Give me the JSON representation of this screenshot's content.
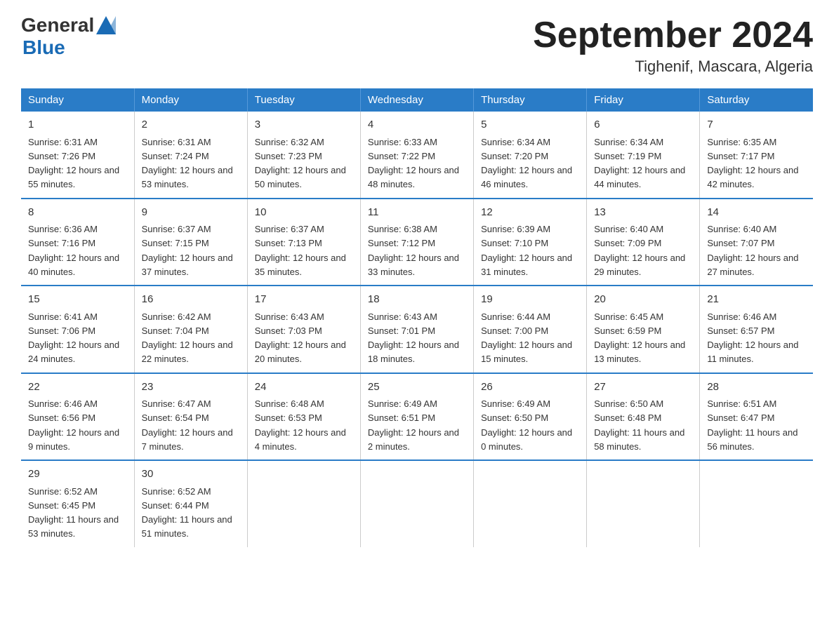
{
  "header": {
    "logo_general": "General",
    "logo_blue": "Blue",
    "month_year": "September 2024",
    "location": "Tighenif, Mascara, Algeria"
  },
  "days_of_week": [
    "Sunday",
    "Monday",
    "Tuesday",
    "Wednesday",
    "Thursday",
    "Friday",
    "Saturday"
  ],
  "weeks": [
    [
      {
        "day": "1",
        "sunrise": "6:31 AM",
        "sunset": "7:26 PM",
        "daylight": "12 hours and 55 minutes."
      },
      {
        "day": "2",
        "sunrise": "6:31 AM",
        "sunset": "7:24 PM",
        "daylight": "12 hours and 53 minutes."
      },
      {
        "day": "3",
        "sunrise": "6:32 AM",
        "sunset": "7:23 PM",
        "daylight": "12 hours and 50 minutes."
      },
      {
        "day": "4",
        "sunrise": "6:33 AM",
        "sunset": "7:22 PM",
        "daylight": "12 hours and 48 minutes."
      },
      {
        "day": "5",
        "sunrise": "6:34 AM",
        "sunset": "7:20 PM",
        "daylight": "12 hours and 46 minutes."
      },
      {
        "day": "6",
        "sunrise": "6:34 AM",
        "sunset": "7:19 PM",
        "daylight": "12 hours and 44 minutes."
      },
      {
        "day": "7",
        "sunrise": "6:35 AM",
        "sunset": "7:17 PM",
        "daylight": "12 hours and 42 minutes."
      }
    ],
    [
      {
        "day": "8",
        "sunrise": "6:36 AM",
        "sunset": "7:16 PM",
        "daylight": "12 hours and 40 minutes."
      },
      {
        "day": "9",
        "sunrise": "6:37 AM",
        "sunset": "7:15 PM",
        "daylight": "12 hours and 37 minutes."
      },
      {
        "day": "10",
        "sunrise": "6:37 AM",
        "sunset": "7:13 PM",
        "daylight": "12 hours and 35 minutes."
      },
      {
        "day": "11",
        "sunrise": "6:38 AM",
        "sunset": "7:12 PM",
        "daylight": "12 hours and 33 minutes."
      },
      {
        "day": "12",
        "sunrise": "6:39 AM",
        "sunset": "7:10 PM",
        "daylight": "12 hours and 31 minutes."
      },
      {
        "day": "13",
        "sunrise": "6:40 AM",
        "sunset": "7:09 PM",
        "daylight": "12 hours and 29 minutes."
      },
      {
        "day": "14",
        "sunrise": "6:40 AM",
        "sunset": "7:07 PM",
        "daylight": "12 hours and 27 minutes."
      }
    ],
    [
      {
        "day": "15",
        "sunrise": "6:41 AM",
        "sunset": "7:06 PM",
        "daylight": "12 hours and 24 minutes."
      },
      {
        "day": "16",
        "sunrise": "6:42 AM",
        "sunset": "7:04 PM",
        "daylight": "12 hours and 22 minutes."
      },
      {
        "day": "17",
        "sunrise": "6:43 AM",
        "sunset": "7:03 PM",
        "daylight": "12 hours and 20 minutes."
      },
      {
        "day": "18",
        "sunrise": "6:43 AM",
        "sunset": "7:01 PM",
        "daylight": "12 hours and 18 minutes."
      },
      {
        "day": "19",
        "sunrise": "6:44 AM",
        "sunset": "7:00 PM",
        "daylight": "12 hours and 15 minutes."
      },
      {
        "day": "20",
        "sunrise": "6:45 AM",
        "sunset": "6:59 PM",
        "daylight": "12 hours and 13 minutes."
      },
      {
        "day": "21",
        "sunrise": "6:46 AM",
        "sunset": "6:57 PM",
        "daylight": "12 hours and 11 minutes."
      }
    ],
    [
      {
        "day": "22",
        "sunrise": "6:46 AM",
        "sunset": "6:56 PM",
        "daylight": "12 hours and 9 minutes."
      },
      {
        "day": "23",
        "sunrise": "6:47 AM",
        "sunset": "6:54 PM",
        "daylight": "12 hours and 7 minutes."
      },
      {
        "day": "24",
        "sunrise": "6:48 AM",
        "sunset": "6:53 PM",
        "daylight": "12 hours and 4 minutes."
      },
      {
        "day": "25",
        "sunrise": "6:49 AM",
        "sunset": "6:51 PM",
        "daylight": "12 hours and 2 minutes."
      },
      {
        "day": "26",
        "sunrise": "6:49 AM",
        "sunset": "6:50 PM",
        "daylight": "12 hours and 0 minutes."
      },
      {
        "day": "27",
        "sunrise": "6:50 AM",
        "sunset": "6:48 PM",
        "daylight": "11 hours and 58 minutes."
      },
      {
        "day": "28",
        "sunrise": "6:51 AM",
        "sunset": "6:47 PM",
        "daylight": "11 hours and 56 minutes."
      }
    ],
    [
      {
        "day": "29",
        "sunrise": "6:52 AM",
        "sunset": "6:45 PM",
        "daylight": "11 hours and 53 minutes."
      },
      {
        "day": "30",
        "sunrise": "6:52 AM",
        "sunset": "6:44 PM",
        "daylight": "11 hours and 51 minutes."
      },
      null,
      null,
      null,
      null,
      null
    ]
  ],
  "labels": {
    "sunrise_prefix": "Sunrise: ",
    "sunset_prefix": "Sunset: ",
    "daylight_prefix": "Daylight: "
  }
}
